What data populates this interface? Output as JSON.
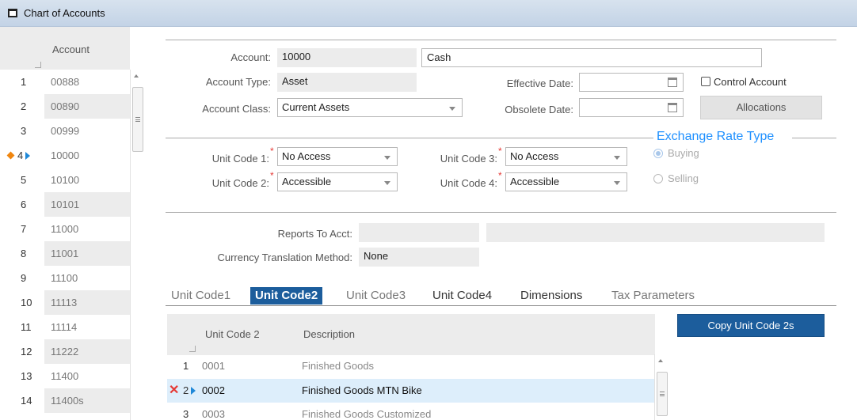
{
  "window": {
    "title": "Chart of Accounts"
  },
  "account_grid": {
    "header": "Account",
    "rows": [
      {
        "num": "1",
        "account": "00888"
      },
      {
        "num": "2",
        "account": "00890"
      },
      {
        "num": "3",
        "account": "00999"
      },
      {
        "num": "4",
        "account": "10000"
      },
      {
        "num": "5",
        "account": "10100"
      },
      {
        "num": "6",
        "account": "10101"
      },
      {
        "num": "7",
        "account": "11000"
      },
      {
        "num": "8",
        "account": "11001"
      },
      {
        "num": "9",
        "account": "11100"
      },
      {
        "num": "10",
        "account": "11113"
      },
      {
        "num": "11",
        "account": "11114"
      },
      {
        "num": "12",
        "account": "11222"
      },
      {
        "num": "13",
        "account": "11400"
      },
      {
        "num": "14",
        "account": "11400s"
      }
    ]
  },
  "form": {
    "account_label": "Account:",
    "account_value": "10000",
    "account_name": "Cash",
    "account_type_label": "Account Type:",
    "account_type_value": "Asset",
    "account_class_label": "Account Class:",
    "account_class_value": "Current Assets",
    "effective_date_label": "Effective Date:",
    "obsolete_date_label": "Obsolete Date:",
    "control_account_label": "Control Account",
    "allocations_label": "Allocations"
  },
  "unit_codes": {
    "uc1_label": "Unit Code 1:",
    "uc1_value": "No Access",
    "uc2_label": "Unit Code 2:",
    "uc2_value": "Accessible",
    "uc3_label": "Unit Code 3:",
    "uc3_value": "No Access",
    "uc4_label": "Unit Code 4:",
    "uc4_value": "Accessible",
    "required_mark": "*"
  },
  "exchange_rate": {
    "title": "Exchange Rate Type",
    "buying_label": "Buying",
    "selling_label": "Selling",
    "selected": "Buying"
  },
  "reports": {
    "reports_to_label": "Reports To Acct:",
    "currency_method_label": "Currency Translation Method:",
    "currency_method_value": "None"
  },
  "tabs": [
    {
      "label": "Unit Code1"
    },
    {
      "label": "Unit Code2"
    },
    {
      "label": "Unit Code3"
    },
    {
      "label": "Unit Code4"
    },
    {
      "label": "Dimensions"
    },
    {
      "label": "Tax Parameters"
    }
  ],
  "sub_grid": {
    "col_code": "Unit Code 2",
    "col_desc": "Description",
    "rows": [
      {
        "num": "1",
        "code": "0001",
        "desc": "Finished Goods"
      },
      {
        "num": "2",
        "code": "0002",
        "desc": "Finished Goods MTN Bike"
      },
      {
        "num": "3",
        "code": "0003",
        "desc": "Finished Goods Customized"
      }
    ],
    "copy_button": "Copy Unit Code 2s"
  },
  "colors": {
    "accent": "#1c5d9c",
    "legend": "#1e90ff",
    "current_marker": "#f0860f",
    "required": "#e53935"
  }
}
